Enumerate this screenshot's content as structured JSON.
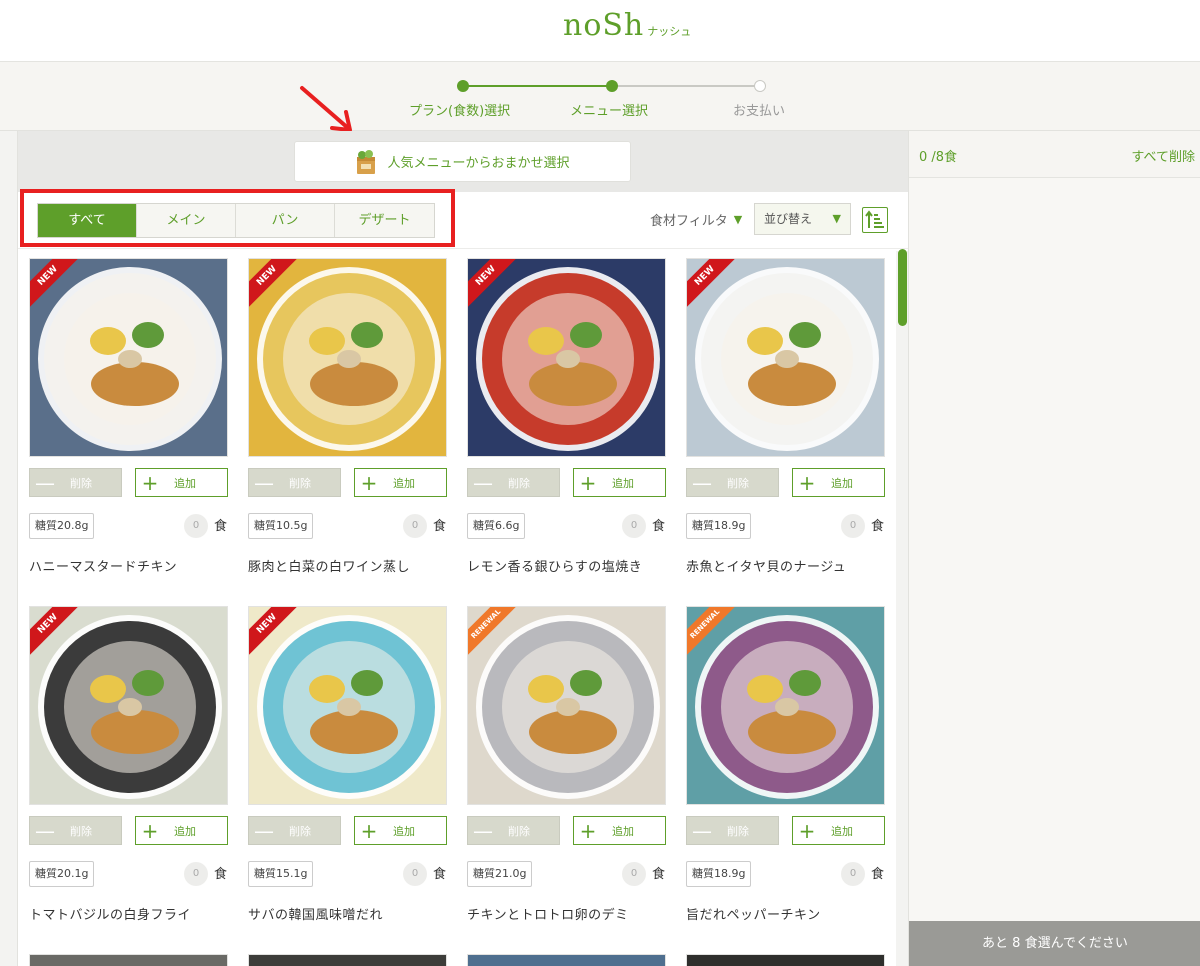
{
  "brand": {
    "logo_main": "noSh",
    "logo_sub": "ナッシュ"
  },
  "steps": [
    {
      "label": "プラン(食数)選択",
      "state": "done"
    },
    {
      "label": "メニュー選択",
      "state": "current"
    },
    {
      "label": "お支払い",
      "state": "todo"
    }
  ],
  "omakase": {
    "label": "人気メニューからおまかせ選択",
    "icon": "shopping-bag-icon"
  },
  "tabs": [
    {
      "label": "すべて",
      "active": true
    },
    {
      "label": "メイン",
      "active": false
    },
    {
      "label": "パン",
      "active": false
    },
    {
      "label": "デザート",
      "active": false
    }
  ],
  "filter": {
    "ingredient_label": "食材フィルタ",
    "sort_label": "並び替え",
    "chevron_icon": "chevron-down-icon",
    "sort_icon": "sort-order-icon"
  },
  "buttons": {
    "remove": "削除",
    "add": "追加",
    "unit": "食"
  },
  "menu": [
    {
      "name": "ハニーマスタードチキン",
      "carb": "糖質20.8g",
      "count": "0",
      "badge": "NEW",
      "plate": "#f4f2ee",
      "table": "#5a6f8a"
    },
    {
      "name": "豚肉と白菜の白ワイン蒸し",
      "carb": "糖質10.5g",
      "count": "0",
      "badge": "NEW",
      "plate": "#e7c65d",
      "table": "#e2b53e"
    },
    {
      "name": "レモン香る銀ひらすの塩焼き",
      "carb": "糖質6.6g",
      "count": "0",
      "badge": "NEW",
      "plate": "#c63b2b",
      "table": "#2c3b67"
    },
    {
      "name": "赤魚とイタヤ貝のナージュ",
      "carb": "糖質18.9g",
      "count": "0",
      "badge": "NEW",
      "plate": "#f4f4f2",
      "table": "#bcc9d3"
    },
    {
      "name": "トマトバジルの白身フライ",
      "carb": "糖質20.1g",
      "count": "0",
      "badge": "NEW",
      "plate": "#3b3b3b",
      "table": "#d9dccf"
    },
    {
      "name": "サバの韓国風味噌だれ",
      "carb": "糖質15.1g",
      "count": "0",
      "badge": "NEW",
      "plate": "#6fc3d4",
      "table": "#efe9c9"
    },
    {
      "name": "チキンとトロトロ卵のデミ",
      "carb": "糖質21.0g",
      "count": "0",
      "badge": "RENEWAL",
      "plate": "#b9b9bd",
      "table": "#ded8cc"
    },
    {
      "name": "旨だれペッパーチキン",
      "carb": "糖質18.9g",
      "count": "0",
      "badge": "RENEWAL",
      "plate": "#8e5a8a",
      "table": "#5f9fa6"
    }
  ],
  "cart": {
    "count_label": "0 /8食",
    "delete_all": "すべて削除",
    "remaining": "あと 8 食選んでください"
  },
  "colors": {
    "brand_green": "#5e9f2a",
    "highlight_red": "#e82020",
    "badge_new": "#d0171b",
    "badge_renewal": "#f0782a"
  }
}
